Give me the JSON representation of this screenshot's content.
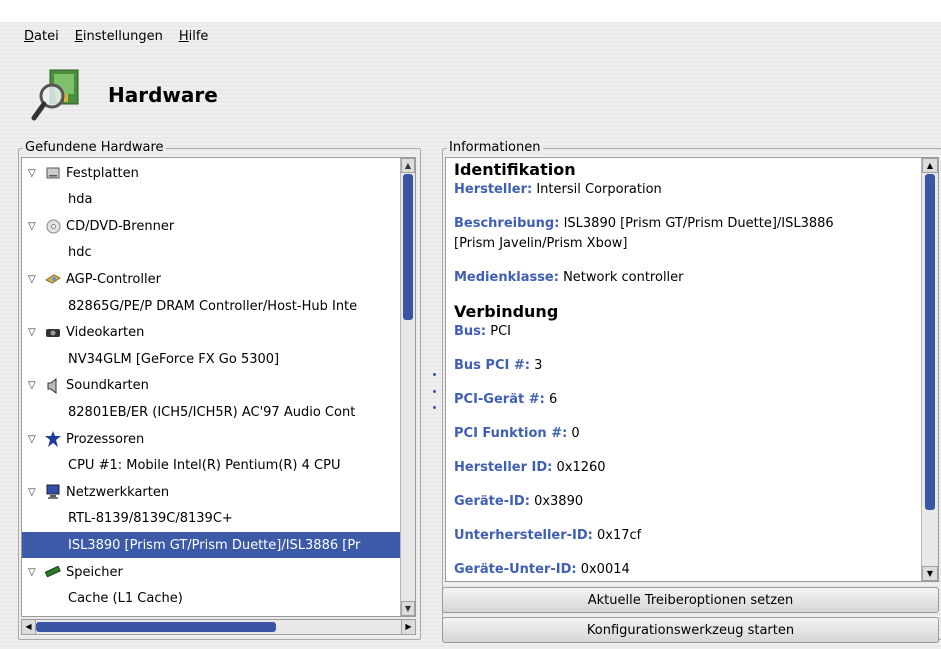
{
  "menubar": {
    "items": [
      {
        "label": "Datei",
        "mnemonic": "D",
        "rest": "atei"
      },
      {
        "label": "Einstellungen",
        "mnemonic": "E",
        "rest": "instellungen"
      },
      {
        "label": "Hilfe",
        "mnemonic": "H",
        "rest": "ilfe"
      }
    ]
  },
  "banner": {
    "title": "Hardware",
    "icon": "hardware-magnifier-icon"
  },
  "left_panel": {
    "legend": "Gefundene Hardware",
    "tree": [
      {
        "type": "cat",
        "label": "Festplatten",
        "icon": "harddisk-icon"
      },
      {
        "type": "child",
        "label": "hda"
      },
      {
        "type": "cat",
        "label": "CD/DVD-Brenner",
        "icon": "cdrom-icon"
      },
      {
        "type": "child",
        "label": "hdc"
      },
      {
        "type": "cat",
        "label": "AGP-Controller",
        "icon": "agp-icon"
      },
      {
        "type": "child",
        "label": "82865G/PE/P DRAM Controller/Host-Hub Inte"
      },
      {
        "type": "cat",
        "label": "Videokarten",
        "icon": "videocard-icon"
      },
      {
        "type": "child",
        "label": "NV34GLM [GeForce FX Go 5300]"
      },
      {
        "type": "cat",
        "label": "Soundkarten",
        "icon": "speaker-icon"
      },
      {
        "type": "child",
        "label": "82801EB/ER (ICH5/ICH5R) AC'97 Audio Cont"
      },
      {
        "type": "cat",
        "label": "Prozessoren",
        "icon": "cpu-icon"
      },
      {
        "type": "child",
        "label": "CPU #1: Mobile Intel(R) Pentium(R) 4     CPU"
      },
      {
        "type": "cat",
        "label": "Netzwerkkarten",
        "icon": "network-icon"
      },
      {
        "type": "child",
        "label": "RTL-8139/8139C/8139C+"
      },
      {
        "type": "child",
        "label": "ISL3890 [Prism GT/Prism Duette]/ISL3886 [Pr",
        "selected": true
      },
      {
        "type": "cat",
        "label": "Speicher",
        "icon": "memory-icon"
      },
      {
        "type": "child",
        "label": "Cache (L1 Cache)"
      }
    ]
  },
  "right_panel": {
    "legend": "Informationen",
    "identifikation_title": "Identifikation",
    "hersteller_k": "Hersteller:",
    "hersteller_v": " Intersil Corporation",
    "beschreibung_k": "Beschreibung:",
    "beschreibung_v": " ISL3890 [Prism GT/Prism Duette]/ISL3886",
    "beschreibung_v2": "[Prism Javelin/Prism Xbow]",
    "medienklasse_k": "Medienklasse:",
    "medienklasse_v": " Network controller",
    "verbindung_title": "Verbindung",
    "bus_k": "Bus:",
    "bus_v": " PCI",
    "buspci_k": "Bus PCI #:",
    "buspci_v": " 3",
    "pcigeraet_k": "PCI-Gerät #:",
    "pcigeraet_v": " 6",
    "pcifunktion_k": "PCI Funktion #:",
    "pcifunktion_v": " 0",
    "herstellerid_k": "Hersteller ID:",
    "herstellerid_v": " 0x1260",
    "geraeteid_k": "Geräte-ID:",
    "geraeteid_v": " 0x3890",
    "unterhersteller_k": "Unterhersteller-ID:",
    "unterhersteller_v": " 0x17cf",
    "geraeteunter_k": "Geräte-Unter-ID:",
    "geraeteunter_v": " 0x0014"
  },
  "buttons": {
    "driver_options": "Aktuelle Treiberoptionen setzen",
    "config_tool": "Konfigurationswerkzeug starten"
  },
  "colors": {
    "accent": "#3c5aa8",
    "field_key": "#3f5fb5"
  }
}
